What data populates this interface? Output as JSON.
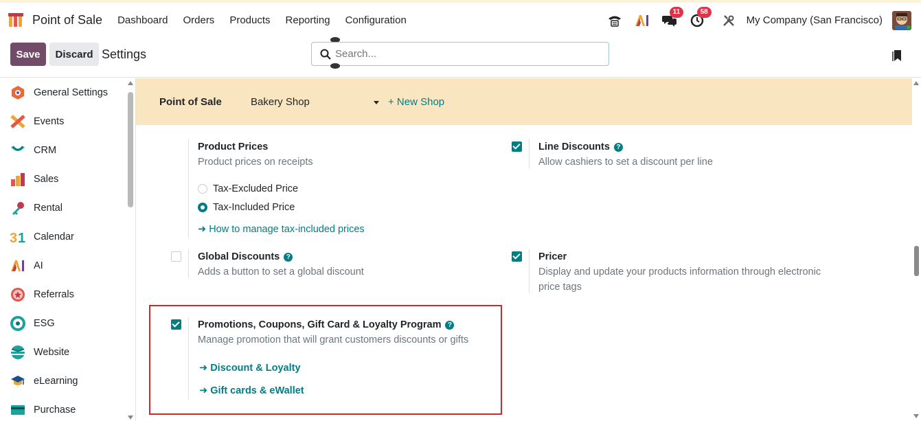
{
  "navbar": {
    "app_name": "Point of Sale",
    "menu": [
      "Dashboard",
      "Orders",
      "Products",
      "Reporting",
      "Configuration"
    ],
    "badges": {
      "messages": "11",
      "activities": "58"
    },
    "company": "My Company (San Francisco)"
  },
  "control": {
    "save_label": "Save",
    "discard_label": "Discard",
    "title": "Settings",
    "search_placeholder": "Search..."
  },
  "sidebar": {
    "items": [
      {
        "label": "General Settings",
        "icon": "general-settings-icon"
      },
      {
        "label": "Events",
        "icon": "events-icon"
      },
      {
        "label": "CRM",
        "icon": "crm-icon"
      },
      {
        "label": "Sales",
        "icon": "sales-icon"
      },
      {
        "label": "Rental",
        "icon": "rental-icon"
      },
      {
        "label": "Calendar",
        "icon": "calendar-icon"
      },
      {
        "label": "AI",
        "icon": "ai-icon"
      },
      {
        "label": "Referrals",
        "icon": "referrals-icon"
      },
      {
        "label": "ESG",
        "icon": "esg-icon"
      },
      {
        "label": "Website",
        "icon": "website-icon"
      },
      {
        "label": "eLearning",
        "icon": "elearning-icon"
      },
      {
        "label": "Purchase",
        "icon": "purchase-icon"
      }
    ]
  },
  "app_bar": {
    "label": "Point of Sale",
    "shop": "Bakery Shop",
    "new_shop": "+ New Shop"
  },
  "settings": {
    "product_prices": {
      "title": "Product Prices",
      "desc": "Product prices on receipts",
      "options": [
        "Tax-Excluded Price",
        "Tax-Included Price"
      ],
      "selected": "Tax-Included Price",
      "link": "How to manage tax-included prices"
    },
    "line_discounts": {
      "title": "Line Discounts",
      "desc": "Allow cashiers to set a discount per line",
      "checked": true
    },
    "global_discounts": {
      "title": "Global Discounts",
      "desc": "Adds a button to set a global discount",
      "checked": false
    },
    "pricer": {
      "title": "Pricer",
      "desc_line1": "Display and update your products information through electronic",
      "desc_line2": "price tags",
      "checked": true
    },
    "promotions": {
      "title": "Promotions, Coupons, Gift Card & Loyalty Program",
      "desc": "Manage promotion that will grant customers discounts or gifts",
      "checked": true,
      "links": [
        "Discount & Loyalty",
        "Gift cards & eWallet"
      ]
    }
  },
  "colors": {
    "primary": "#714b67",
    "teal": "#017e84",
    "app_bar_bg": "#f9e6c0",
    "highlight": "#d0272c"
  }
}
